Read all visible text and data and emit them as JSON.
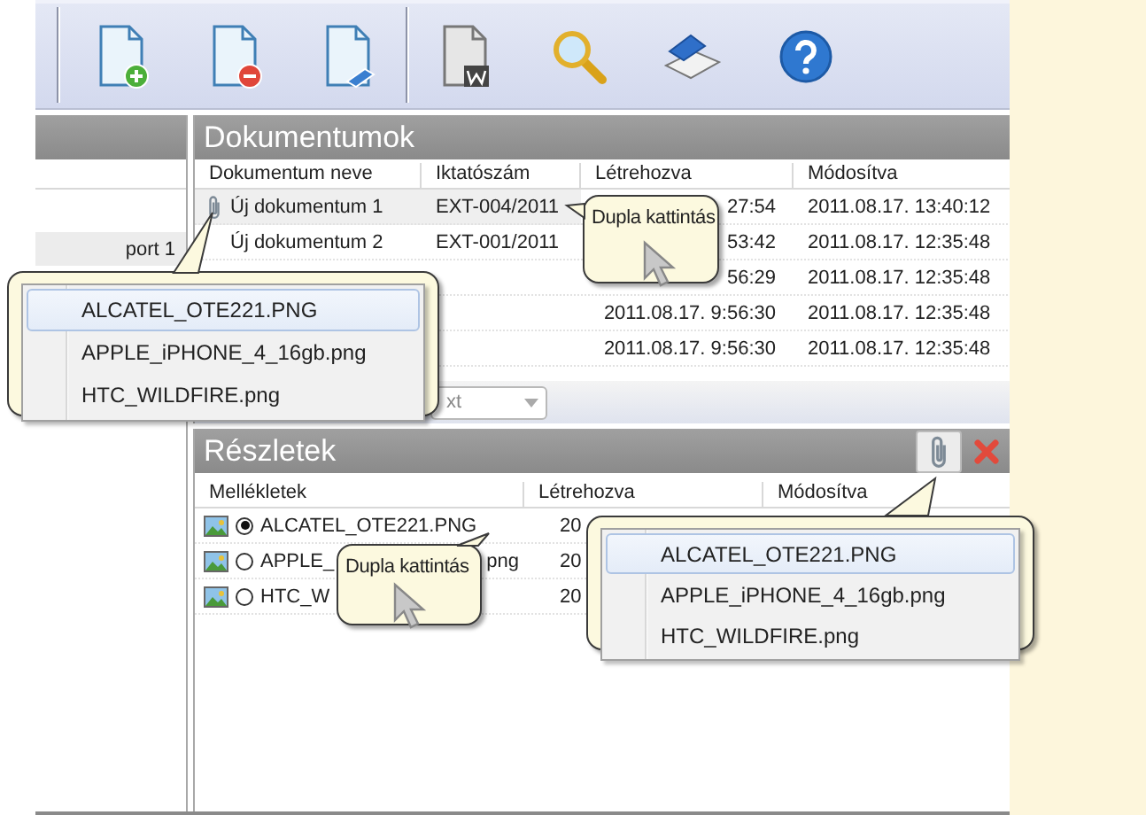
{
  "sidebar": {
    "items": [
      {
        "label": "port 1",
        "selected": true
      }
    ]
  },
  "documents": {
    "title": "Dokumentumok",
    "columns": [
      "Dokumentum neve",
      "Iktatószám",
      "Létrehozva",
      "Módosítva"
    ],
    "rows": [
      {
        "name": "Új dokumentum 1",
        "number": "EXT-004/2011",
        "created": "27:54",
        "modified": "2011.08.17. 13:40:12",
        "attachment": true,
        "selected": true
      },
      {
        "name": "Új dokumentum 2",
        "number": "EXT-001/2011",
        "created": "53:42",
        "modified": "2011.08.17. 12:35:48",
        "attachment": false,
        "selected": false
      },
      {
        "created": "56:29",
        "modified": "2011.08.17. 12:35:48",
        "attachment": false,
        "selected": false
      },
      {
        "created": "2011.08.17. 9:56:30",
        "modified": "2011.08.17. 12:35:48",
        "attachment": false,
        "selected": false
      },
      {
        "created": "2011.08.17. 9:56:30",
        "modified": "2011.08.17. 12:35:48",
        "attachment": false,
        "selected": false
      }
    ]
  },
  "filter": {
    "value": "xt"
  },
  "details": {
    "title": "Részletek",
    "columns": [
      "Mellékletek",
      "Létrehozva",
      "Módosítva"
    ],
    "rows": [
      {
        "name": "ALCATEL_OTE221.PNG",
        "created": "20",
        "selected": true
      },
      {
        "name": "APPLE_",
        "name_tail": "png",
        "created": "20",
        "selected": false
      },
      {
        "name": "HTC_W",
        "created": "20",
        "selected": false
      }
    ]
  },
  "callouts": [
    {
      "kind": "menu",
      "items": [
        {
          "label": "ALCATEL_OTE221.PNG",
          "selected": true
        },
        {
          "label": "APPLE_iPHONE_4_16gb.png",
          "selected": false
        },
        {
          "label": "HTC_WILDFIRE.png",
          "selected": false
        }
      ]
    },
    {
      "kind": "hint",
      "text": "Dupla kattintás"
    },
    {
      "kind": "hint",
      "text": "Dupla kattintás"
    },
    {
      "kind": "menu",
      "items": [
        {
          "label": "ALCATEL_OTE221.PNG",
          "selected": true
        },
        {
          "label": "APPLE_iPHONE_4_16gb.png",
          "selected": false
        },
        {
          "label": "HTC_WILDFIRE.png",
          "selected": false
        }
      ]
    }
  ]
}
